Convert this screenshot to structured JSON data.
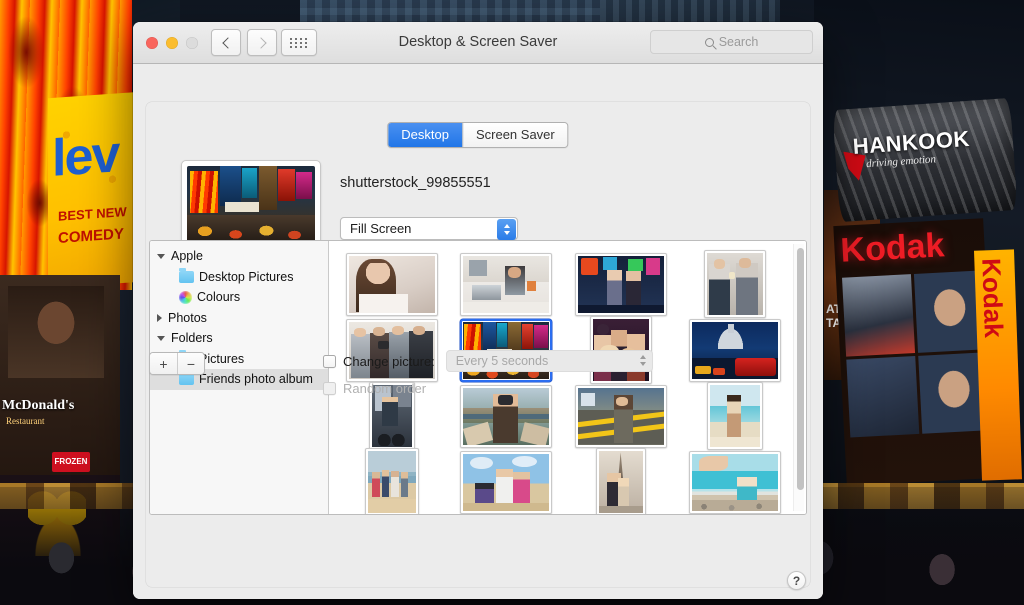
{
  "window": {
    "title": "Desktop & Screen Saver",
    "traffic_lights": [
      "close",
      "minimize",
      "zoom"
    ],
    "nav": {
      "back": "‹",
      "forward": "›",
      "show_all": "grid-view"
    },
    "search": {
      "placeholder": "Search",
      "value": ""
    }
  },
  "tabs": [
    {
      "label": "Desktop",
      "active": true
    },
    {
      "label": "Screen Saver",
      "active": false
    }
  ],
  "selection": {
    "picture_name": "shutterstock_99855551",
    "fit_mode": "Fill Screen"
  },
  "sidebar": {
    "items": [
      {
        "label": "Apple",
        "type": "group",
        "disclosure": "down",
        "indent": 0,
        "selected": false
      },
      {
        "label": "Desktop Pictures",
        "type": "folder",
        "indent": 1,
        "selected": false
      },
      {
        "label": "Colours",
        "type": "color-wheel",
        "indent": 1,
        "selected": false
      },
      {
        "label": "Photos",
        "type": "group",
        "disclosure": "right",
        "indent": 0,
        "selected": false
      },
      {
        "label": "Folders",
        "type": "group",
        "disclosure": "down",
        "indent": 0,
        "selected": false
      },
      {
        "label": "Pictures",
        "type": "folder-camera",
        "indent": 1,
        "selected": false
      },
      {
        "label": "Friends photo album",
        "type": "folder",
        "indent": 1,
        "selected": true
      }
    ]
  },
  "thumbnails": [
    {
      "id": 1,
      "orientation": "landscape",
      "selected": false,
      "scene": "woman-portrait-white"
    },
    {
      "id": 2,
      "orientation": "landscape",
      "selected": false,
      "scene": "woman-laptop-kitchen"
    },
    {
      "id": 3,
      "orientation": "landscape",
      "selected": false,
      "scene": "two-women-night-street"
    },
    {
      "id": 4,
      "orientation": "portrait",
      "selected": false,
      "scene": "couple-toasting-drinks"
    },
    {
      "id": 5,
      "orientation": "landscape",
      "selected": false,
      "scene": "group-friends-camera"
    },
    {
      "id": 6,
      "orientation": "landscape",
      "selected": true,
      "scene": "times-square-daylight"
    },
    {
      "id": 7,
      "orientation": "portrait",
      "selected": false,
      "scene": "friends-party-group"
    },
    {
      "id": 8,
      "orientation": "landscape",
      "selected": false,
      "scene": "london-bus-cathedral-night"
    },
    {
      "id": 9,
      "orientation": "portrait",
      "selected": false,
      "scene": "cyclist-city-street"
    },
    {
      "id": 10,
      "orientation": "landscape",
      "selected": false,
      "scene": "selfie-couple-hilltown"
    },
    {
      "id": 11,
      "orientation": "landscape",
      "selected": false,
      "scene": "woman-yellow-crosswalk"
    },
    {
      "id": 12,
      "orientation": "portrait",
      "selected": false,
      "scene": "woman-walking-beach"
    },
    {
      "id": 13,
      "orientation": "portrait",
      "selected": false,
      "scene": "family-on-beach"
    },
    {
      "id": 14,
      "orientation": "landscape",
      "selected": false,
      "scene": "friends-jumping-beach"
    },
    {
      "id": 15,
      "orientation": "portrait",
      "selected": false,
      "scene": "mother-child-eiffel-tower"
    },
    {
      "id": 16,
      "orientation": "landscape",
      "selected": false,
      "scene": "child-reaching-hand-sea"
    }
  ],
  "footer": {
    "add_label": "+",
    "remove_label": "−",
    "change_picture_label": "Change picture:",
    "change_picture_checked": false,
    "interval_value": "Every 5 seconds",
    "interval_enabled": false,
    "random_order_label": "Random order",
    "random_order_checked": false,
    "random_order_enabled": false,
    "help_label": "?"
  },
  "desktop_background": {
    "scene": "times-square-new-york-night",
    "signs": {
      "fire_billboard": "",
      "nev_title": "lev",
      "best_new": "BEST NEW",
      "comedy": "COMEDY",
      "mcdonalds": "McDonald's",
      "mcdonalds_sub": "Restaurant",
      "frozen": "FROZEN",
      "hankook": "HANKOOK",
      "hankook_tagline": "driving emotion",
      "kodak": "Kodak",
      "kodak_vertical": "Kodak",
      "wrath": "ATH\nTANS"
    }
  },
  "colors": {
    "accent_blue": "#2176e8",
    "selection_border": "#2b6df0",
    "window_bg": "#ececec",
    "panel_bg": "#ffffff",
    "sidebar_bg": "#f7f7f7",
    "row_selected": "#dedede"
  }
}
